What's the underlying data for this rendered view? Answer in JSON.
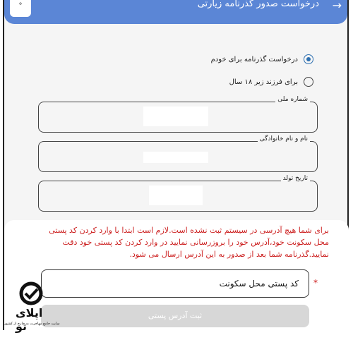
{
  "header": {
    "title": "درخواست صدور گذرنامه زیارتی",
    "back_icon": "→",
    "badge_icon": "°"
  },
  "applicant_options": [
    {
      "label": "درخواست گذرنامه برای خودم",
      "selected": true
    },
    {
      "label": "برای فرزند زیر ۱۸ سال",
      "selected": false
    }
  ],
  "fields": {
    "national_id": {
      "label": "شماره ملی"
    },
    "full_name": {
      "label": "نام و نام خانوادگی"
    },
    "birth_date": {
      "label": "تاریخ تولد"
    }
  },
  "address": {
    "message": "برای شما هیچ آدرسی در سیستم ثبت نشده است.لازم است ابتدا با وارد کردن کد پستی محل سکونت خود،آدرس خود را بروزرسانی نمایید در وارد کردن کد پستی خود دقت نمایید.گذرنامه شما بعد از صدور به این آدرس ارسال می شود.",
    "required_mark": "*",
    "postal_placeholder": "کد پستی محل سکونت",
    "submit_label": "ثبت آدرس پستی"
  },
  "watermark": {
    "brand": "اپلای تو",
    "tagline": "سایت جامع مهاجرت به خارج از کشور"
  },
  "colors": {
    "header": "#5b86d6",
    "radio_selected": "#2d6fb0",
    "warning_text": "#cc1f1f",
    "submit_disabled": "#d7d7d7"
  }
}
